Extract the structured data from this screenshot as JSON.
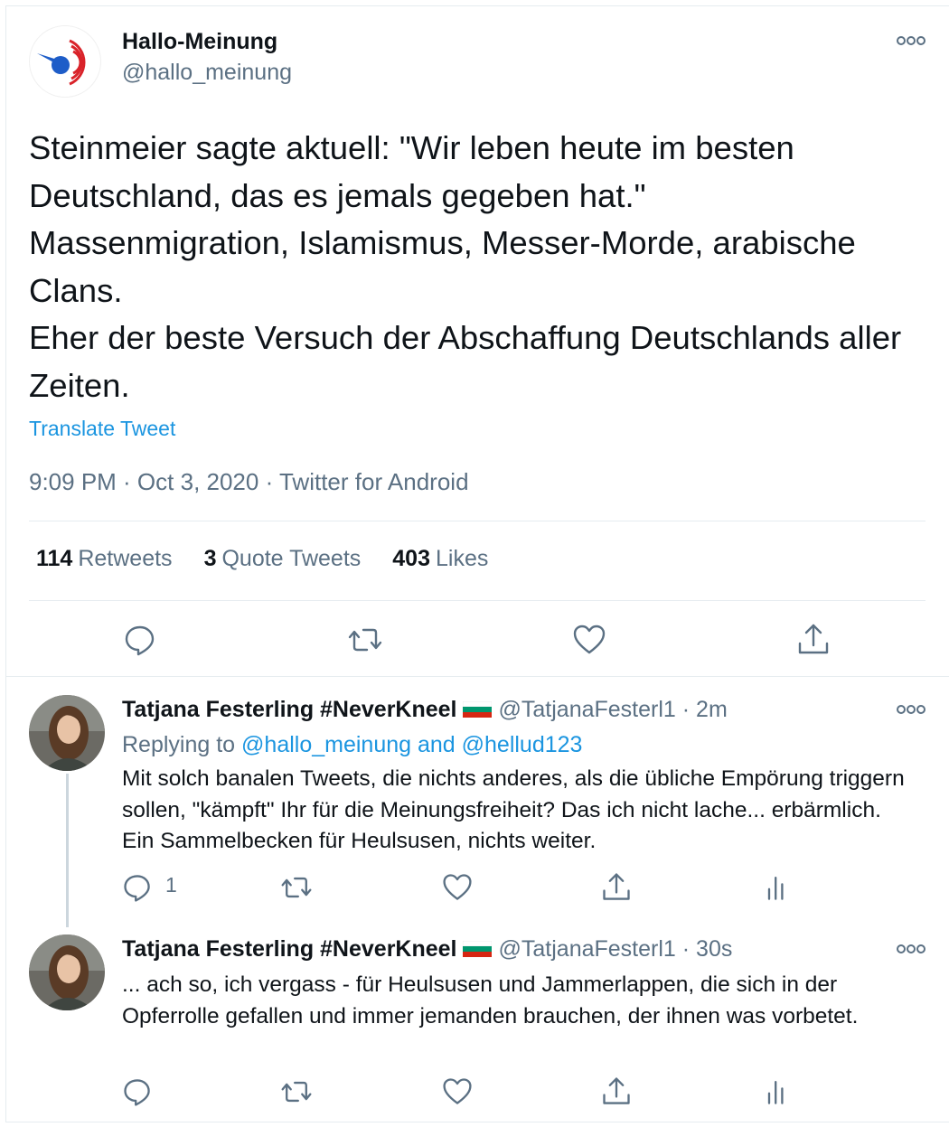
{
  "main_tweet": {
    "author_name": "Hallo-Meinung",
    "author_handle": "@hallo_meinung",
    "text": "Steinmeier sagte aktuell: \"Wir leben heute im besten Deutschland, das es jemals gegeben hat.\"\nMassenmigration, Islamismus, Messer-Morde, arabische Clans.\nEher der beste Versuch der Abschaffung Deutschlands aller Zeiten.",
    "translate_label": "Translate Tweet",
    "meta": "9:09 PM · Oct 3, 2020 · Twitter for Android",
    "retweets_count": "114",
    "retweets_label": "Retweets",
    "quotes_count": "3",
    "quotes_label": "Quote Tweets",
    "likes_count": "403",
    "likes_label": "Likes"
  },
  "replies": [
    {
      "author_name": "Tatjana Festerling #NeverKneel",
      "handle_time": "@TatjanaFesterl1 · 2m",
      "replying_prefix": "Replying to ",
      "replying_users": "@hallo_meinung and @hellud123",
      "text": "Mit solch banalen Tweets, die nichts anderes, als die übliche Empörung triggern sollen, \"kämpft\" Ihr für die Meinungsfreiheit? Das ich nicht lache... erbärmlich. Ein Sammelbecken für Heulsusen, nichts weiter.",
      "reply_count": "1"
    },
    {
      "author_name": "Tatjana Festerling #NeverKneel",
      "handle_time": "@TatjanaFesterl1 · 30s",
      "text": "... ach so, ich vergass - für Heulsusen und Jammerlappen, die sich in der Opferrolle gefallen und immer jemanden brauchen, der ihnen was vorbetet."
    }
  ],
  "icons": [
    "more-icon",
    "reply-icon",
    "retweet-icon",
    "like-icon",
    "share-icon",
    "analytics-icon",
    "bulgaria-flag-icon"
  ],
  "colors": {
    "accent": "#1b95e0",
    "secondary_text": "#5b7083",
    "primary_text": "#0f1419",
    "icon": "#5b7083",
    "logo_red": "#d9232a",
    "logo_blue": "#1e5dc8"
  }
}
